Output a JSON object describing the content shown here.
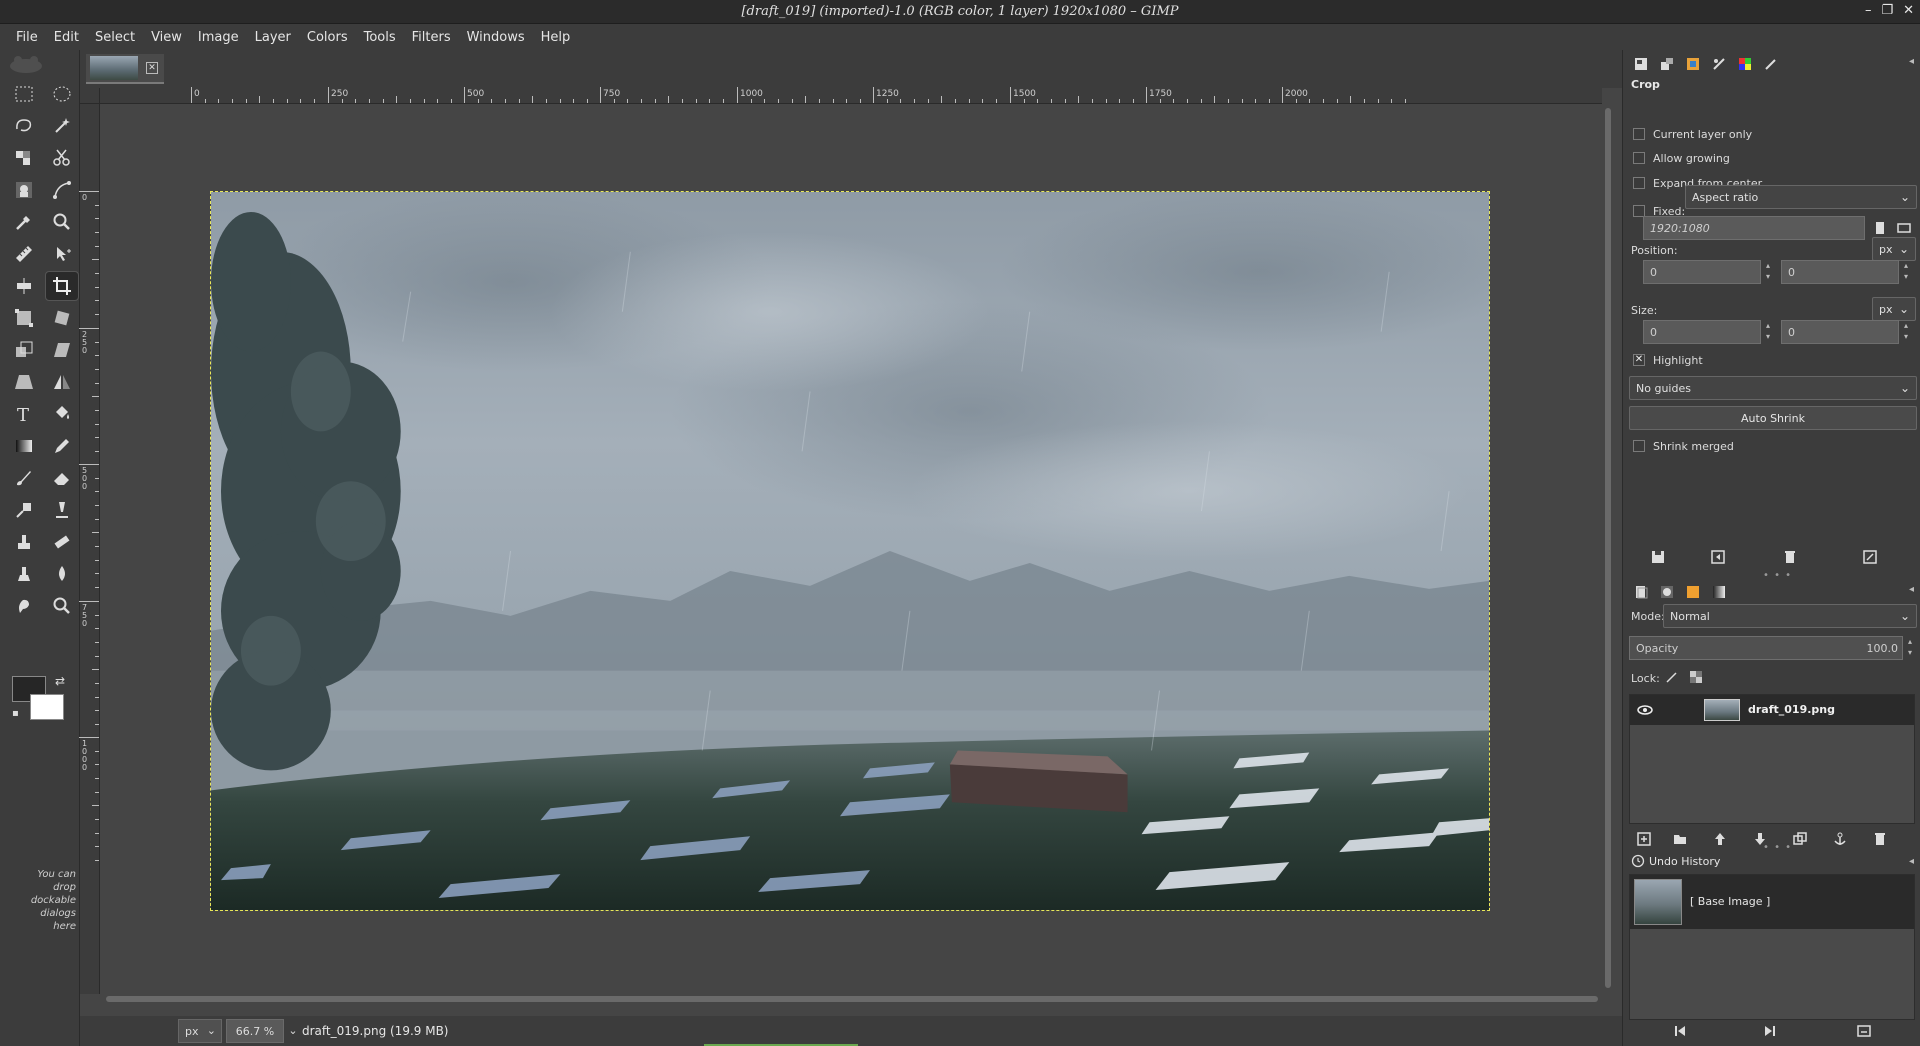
{
  "window": {
    "title": "[draft_019] (imported)-1.0 (RGB color, 1 layer) 1920x1080 – GIMP",
    "controls": [
      "–",
      "❐",
      "✕"
    ]
  },
  "menu": [
    "File",
    "Edit",
    "Select",
    "View",
    "Image",
    "Layer",
    "Colors",
    "Tools",
    "Filters",
    "Windows",
    "Help"
  ],
  "toolbox": {
    "tools": [
      "rect-select-icon",
      "ellipse-select-icon",
      "free-select-icon",
      "fuzzy-select-icon",
      "by-color-select-icon",
      "scissors-select-icon",
      "foreground-select-icon",
      "paths-icon",
      "color-picker-icon",
      "zoom-icon",
      "measure-icon",
      "move-icon",
      "alignment-icon",
      "crop-icon",
      "unified-transform-icon",
      "rotate-icon",
      "scale-icon",
      "shear-icon",
      "perspective-icon",
      "flip-icon",
      "text-icon",
      "bucket-fill-icon",
      "gradient-icon",
      "pencil-icon",
      "paintbrush-icon",
      "eraser-icon",
      "airbrush-icon",
      "ink-icon",
      "clone-icon",
      "heal-icon",
      "perspective-clone-icon",
      "blur-icon",
      "smudge-icon",
      "dodge-burn-icon"
    ],
    "active_tool": "crop-icon",
    "fg_color": "#262626",
    "bg_color": "#ffffff",
    "drop_note": "You can drop dockable dialogs here"
  },
  "canvas": {
    "ruler_h": [
      "0",
      "250",
      "500",
      "750",
      "1000",
      "1250",
      "1500",
      "1750",
      "2000"
    ],
    "ruler_v": [
      "0",
      "250",
      "500",
      "750",
      "1000"
    ],
    "image_name": "draft_019.png"
  },
  "status": {
    "unit": "px",
    "zoom": "66.7 %",
    "text": "draft_019.png (19.9 MB)"
  },
  "tool_options": {
    "title": "Crop",
    "current_layer_only": "Current layer only",
    "allow_growing": "Allow growing",
    "expand_from_center": "Expand from center",
    "fixed_label": "Fixed:",
    "fixed_value": "Aspect ratio",
    "ratio_value": "1920:1080",
    "position_label": "Position:",
    "position_unit": "px",
    "position_x": "0",
    "position_y": "0",
    "size_label": "Size:",
    "size_unit": "px",
    "size_w": "0",
    "size_h": "0",
    "highlight": "Highlight",
    "highlight_checked": "✕",
    "guides": "No guides",
    "auto_shrink": "Auto Shrink",
    "shrink_merged": "Shrink merged"
  },
  "layers": {
    "mode_label": "Mode:",
    "mode_value": "Normal",
    "opacity_label": "Opacity",
    "opacity_value": "100.0",
    "lock_label": "Lock:",
    "items": [
      {
        "name": "draft_019.png",
        "visible": true
      }
    ]
  },
  "history": {
    "title": "Undo History",
    "items": [
      "[ Base Image ]"
    ]
  }
}
